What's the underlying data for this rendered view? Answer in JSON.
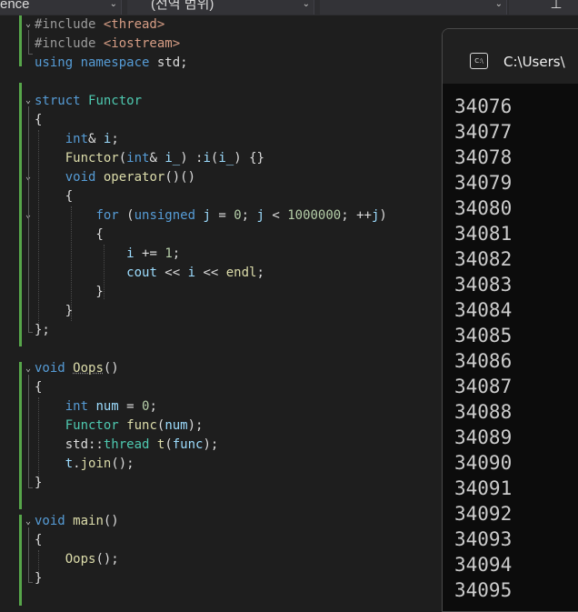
{
  "toolbar": {
    "scope_dropdown": "ence",
    "member_dropdown": "(전역 범위)",
    "third_dropdown": "",
    "pin_glyph": "⊥"
  },
  "editor": {
    "lines": [
      [
        [
          "pl",
          "⌄"
        ]
      ],
      [
        [
          "pp",
          "#include "
        ],
        [
          "str",
          "<thread>"
        ]
      ],
      [
        [
          "pp",
          "#include "
        ],
        [
          "str",
          "<iostream>"
        ]
      ],
      [
        [
          "kw",
          "using namespace "
        ],
        [
          "pl",
          "std;"
        ]
      ],
      [],
      [
        [
          "kw",
          "struct "
        ],
        [
          "ty",
          "Functor"
        ]
      ],
      [
        [
          "pl",
          "{"
        ]
      ],
      [
        [
          "pl",
          "    "
        ],
        [
          "kw",
          "int"
        ],
        [
          "pl",
          "& "
        ],
        [
          "var",
          "i"
        ],
        [
          "pl",
          ";"
        ]
      ],
      [
        [
          "pl",
          "    "
        ],
        [
          "fn",
          "Functor"
        ],
        [
          "pl",
          "("
        ],
        [
          "kw",
          "int"
        ],
        [
          "pl",
          "& "
        ],
        [
          "var",
          "i_"
        ],
        [
          "pl",
          ") :"
        ],
        [
          "var",
          "i"
        ],
        [
          "pl",
          "("
        ],
        [
          "var",
          "i_"
        ],
        [
          "pl",
          ") {}"
        ]
      ],
      [
        [
          "pl",
          "    "
        ],
        [
          "kw",
          "void "
        ],
        [
          "fn",
          "operator"
        ],
        [
          "pl",
          "()()"
        ]
      ],
      [
        [
          "pl",
          "    {"
        ]
      ],
      [
        [
          "pl",
          "        "
        ],
        [
          "kw",
          "for "
        ],
        [
          "pl",
          "("
        ],
        [
          "kw",
          "unsigned "
        ],
        [
          "var",
          "j"
        ],
        [
          "pl",
          " = "
        ],
        [
          "num",
          "0"
        ],
        [
          "pl",
          "; "
        ],
        [
          "var",
          "j"
        ],
        [
          "pl",
          " < "
        ],
        [
          "num",
          "1000000"
        ],
        [
          "pl",
          "; ++"
        ],
        [
          "var",
          "j"
        ],
        [
          "pl",
          ")"
        ]
      ],
      [
        [
          "pl",
          "        {"
        ]
      ],
      [
        [
          "pl",
          "            "
        ],
        [
          "var",
          "i"
        ],
        [
          "pl",
          " += "
        ],
        [
          "num",
          "1"
        ],
        [
          "pl",
          ";"
        ]
      ],
      [
        [
          "pl",
          "            "
        ],
        [
          "var",
          "cout"
        ],
        [
          "pl",
          " << "
        ],
        [
          "var",
          "i"
        ],
        [
          "pl",
          " << "
        ],
        [
          "fn",
          "endl"
        ],
        [
          "pl",
          ";"
        ]
      ],
      [
        [
          "pl",
          "        }"
        ]
      ],
      [
        [
          "pl",
          "    }"
        ]
      ],
      [
        [
          "pl",
          "};"
        ]
      ],
      [],
      [
        [
          "kw",
          "void "
        ],
        [
          "fn",
          "Oops"
        ],
        [
          "pl",
          "()"
        ]
      ],
      [
        [
          "pl",
          "{"
        ]
      ],
      [
        [
          "pl",
          "    "
        ],
        [
          "kw",
          "int "
        ],
        [
          "var",
          "num"
        ],
        [
          "pl",
          " = "
        ],
        [
          "num",
          "0"
        ],
        [
          "pl",
          ";"
        ]
      ],
      [
        [
          "pl",
          "    "
        ],
        [
          "ty",
          "Functor "
        ],
        [
          "fn",
          "func"
        ],
        [
          "pl",
          "("
        ],
        [
          "var",
          "num"
        ],
        [
          "pl",
          ");"
        ]
      ],
      [
        [
          "pl",
          "    std::"
        ],
        [
          "ty",
          "thread "
        ],
        [
          "fn",
          "t"
        ],
        [
          "pl",
          "("
        ],
        [
          "var",
          "func"
        ],
        [
          "pl",
          ");"
        ]
      ],
      [
        [
          "pl",
          "    "
        ],
        [
          "var",
          "t"
        ],
        [
          "pl",
          "."
        ],
        [
          "fn",
          "join"
        ],
        [
          "pl",
          "();"
        ]
      ],
      [
        [
          "pl",
          "}"
        ]
      ],
      [],
      [
        [
          "kw",
          "void "
        ],
        [
          "fn",
          "main"
        ],
        [
          "pl",
          "()"
        ]
      ],
      [
        [
          "pl",
          "{"
        ]
      ],
      [
        [
          "pl",
          "    "
        ],
        [
          "fn",
          "Oops"
        ],
        [
          "pl",
          "();"
        ]
      ],
      [
        [
          "pl",
          "}"
        ]
      ]
    ]
  },
  "console": {
    "title": "C:\\Users\\",
    "icon_label": "C:\\",
    "output": [
      "34076",
      "34077",
      "34078",
      "34079",
      "34080",
      "34081",
      "34082",
      "34083",
      "34084",
      "34085",
      "34086",
      "34087",
      "34088",
      "34089",
      "34090",
      "34091",
      "34092",
      "34093",
      "34094",
      "34095"
    ]
  }
}
